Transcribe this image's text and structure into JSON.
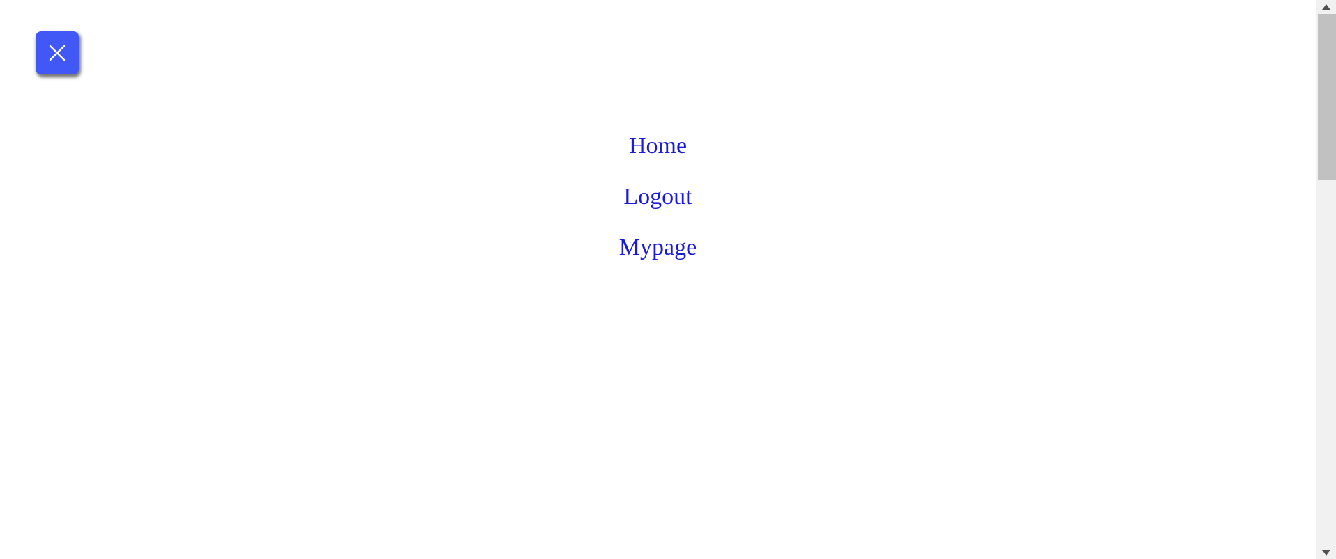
{
  "close_button": {
    "icon": "close-icon",
    "color": "#4157f6"
  },
  "menu": {
    "link_color": "#1a1adb",
    "items": [
      {
        "label": "Home"
      },
      {
        "label": "Logout"
      },
      {
        "label": "Mypage"
      }
    ]
  },
  "scrollbar": {
    "up_icon": "chevron-up-icon",
    "down_icon": "chevron-down-icon"
  }
}
